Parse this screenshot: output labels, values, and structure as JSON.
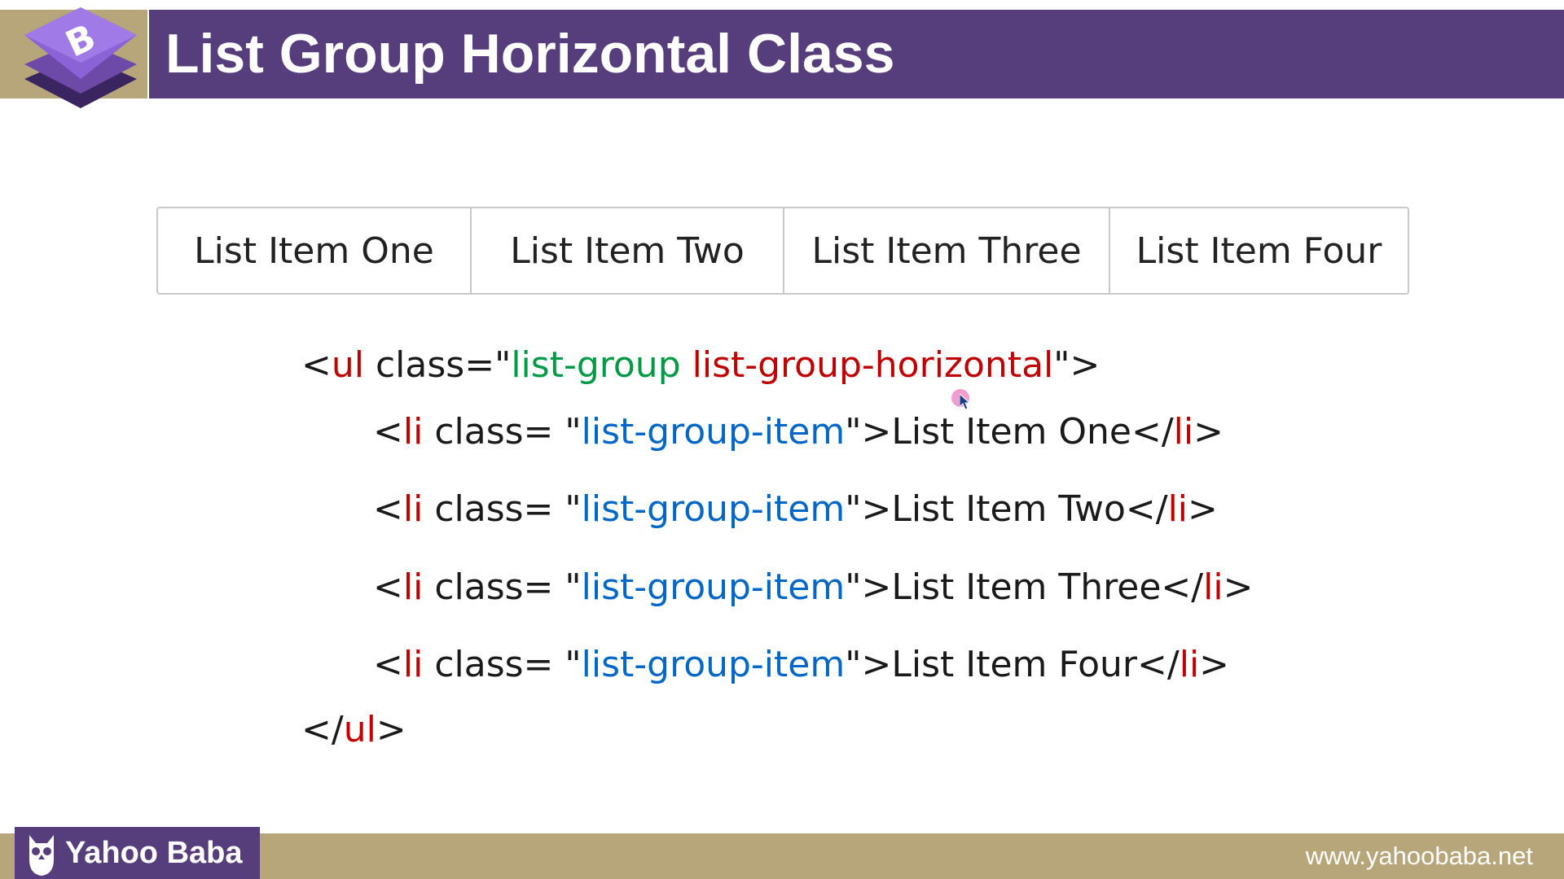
{
  "header": {
    "title": "List Group Horizontal Class",
    "logo_letter": "B"
  },
  "list_group": {
    "items": [
      "List Item One",
      "List Item Two",
      "List Item Three",
      "List Item Four"
    ]
  },
  "code": {
    "open_lt": "<",
    "ul_tag": "ul",
    "ul_attr": " class=\"",
    "cls_list_group": "list-group",
    "space": " ",
    "cls_horizontal": "list-group-horizontal",
    "ul_close_quote": "\">",
    "li_lt": "<",
    "li_tag": "li",
    "li_attr": " class= \"",
    "li_class": "list-group-item",
    "li_quote_gt": "\">",
    "end_lt": "</",
    "gt": ">",
    "item_texts": [
      "List Item One",
      "List Item Two",
      "List Item Three",
      "List Item Four"
    ],
    "close_lt": "</",
    "close_ul_tag": "ul",
    "close_gt": ">"
  },
  "footer": {
    "brand": "Yahoo Baba",
    "url": "www.yahoobaba.net"
  },
  "colors": {
    "header_purple": "#563d7c",
    "tan": "#b7a67a",
    "tag_red": "#c00000",
    "class_green": "#009a46",
    "class_blue": "#0067c6"
  },
  "icons": [
    "bootstrap-logo-icon",
    "owl-icon",
    "mouse-cursor-icon"
  ]
}
